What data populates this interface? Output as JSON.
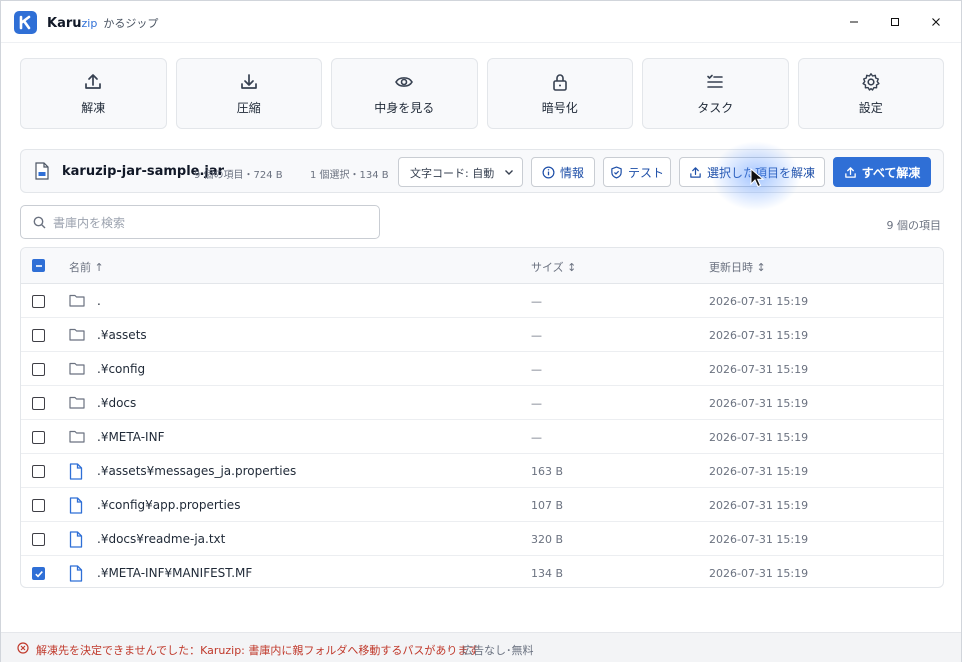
{
  "app": {
    "name_main": "Karu",
    "name_zip": "zip",
    "name_kana": "かるジップ"
  },
  "toolbar": {
    "items": [
      {
        "label": "解凍",
        "icon": "upload-icon"
      },
      {
        "label": "圧縮",
        "icon": "download-icon"
      },
      {
        "label": "中身を見る",
        "icon": "eye-icon"
      },
      {
        "label": "暗号化",
        "icon": "lock-icon"
      },
      {
        "label": "タスク",
        "icon": "list-check-icon"
      },
      {
        "label": "設定",
        "icon": "gear-icon"
      }
    ]
  },
  "archive": {
    "file_name": "karuzip-jar-sample.jar",
    "meta": "9 個の項目・724 B",
    "selection": "1 個選択・134 B",
    "encoding": "文字コード: 自動",
    "info_label": "情報",
    "test_label": "テスト",
    "extract_selected_label": "選択した項目を解凍",
    "extract_all_label": "すべて解凍"
  },
  "search": {
    "placeholder": "書庫内を検索",
    "value": ""
  },
  "item_count": "9 個の項目",
  "table": {
    "col_name": "名前 ↑",
    "col_size": "サイズ ↕",
    "col_date": "更新日時 ↕",
    "rows": [
      {
        "name": ".",
        "type": "folder",
        "size": "—",
        "date": "2026-07-31 15:19",
        "checked": false
      },
      {
        "name": ".¥assets",
        "type": "folder",
        "size": "—",
        "date": "2026-07-31 15:19",
        "checked": false
      },
      {
        "name": ".¥config",
        "type": "folder",
        "size": "—",
        "date": "2026-07-31 15:19",
        "checked": false
      },
      {
        "name": ".¥docs",
        "type": "folder",
        "size": "—",
        "date": "2026-07-31 15:19",
        "checked": false
      },
      {
        "name": ".¥META-INF",
        "type": "folder",
        "size": "—",
        "date": "2026-07-31 15:19",
        "checked": false
      },
      {
        "name": ".¥assets¥messages_ja.properties",
        "type": "file",
        "size": "163 B",
        "date": "2026-07-31 15:19",
        "checked": false
      },
      {
        "name": ".¥config¥app.properties",
        "type": "file",
        "size": "107 B",
        "date": "2026-07-31 15:19",
        "checked": false
      },
      {
        "name": ".¥docs¥readme-ja.txt",
        "type": "file",
        "size": "320 B",
        "date": "2026-07-31 15:19",
        "checked": false
      },
      {
        "name": ".¥META-INF¥MANIFEST.MF",
        "type": "file",
        "size": "134 B",
        "date": "2026-07-31 15:19",
        "checked": true
      }
    ]
  },
  "status": {
    "error": "解凍先を決定できませんでした：Karuzip: 書庫内に親フォルダへ移動するパスがあります",
    "separator": "·",
    "ad": "広告なし･無料"
  },
  "colors": {
    "accent": "#2f6fd6",
    "error": "#c0392b"
  }
}
